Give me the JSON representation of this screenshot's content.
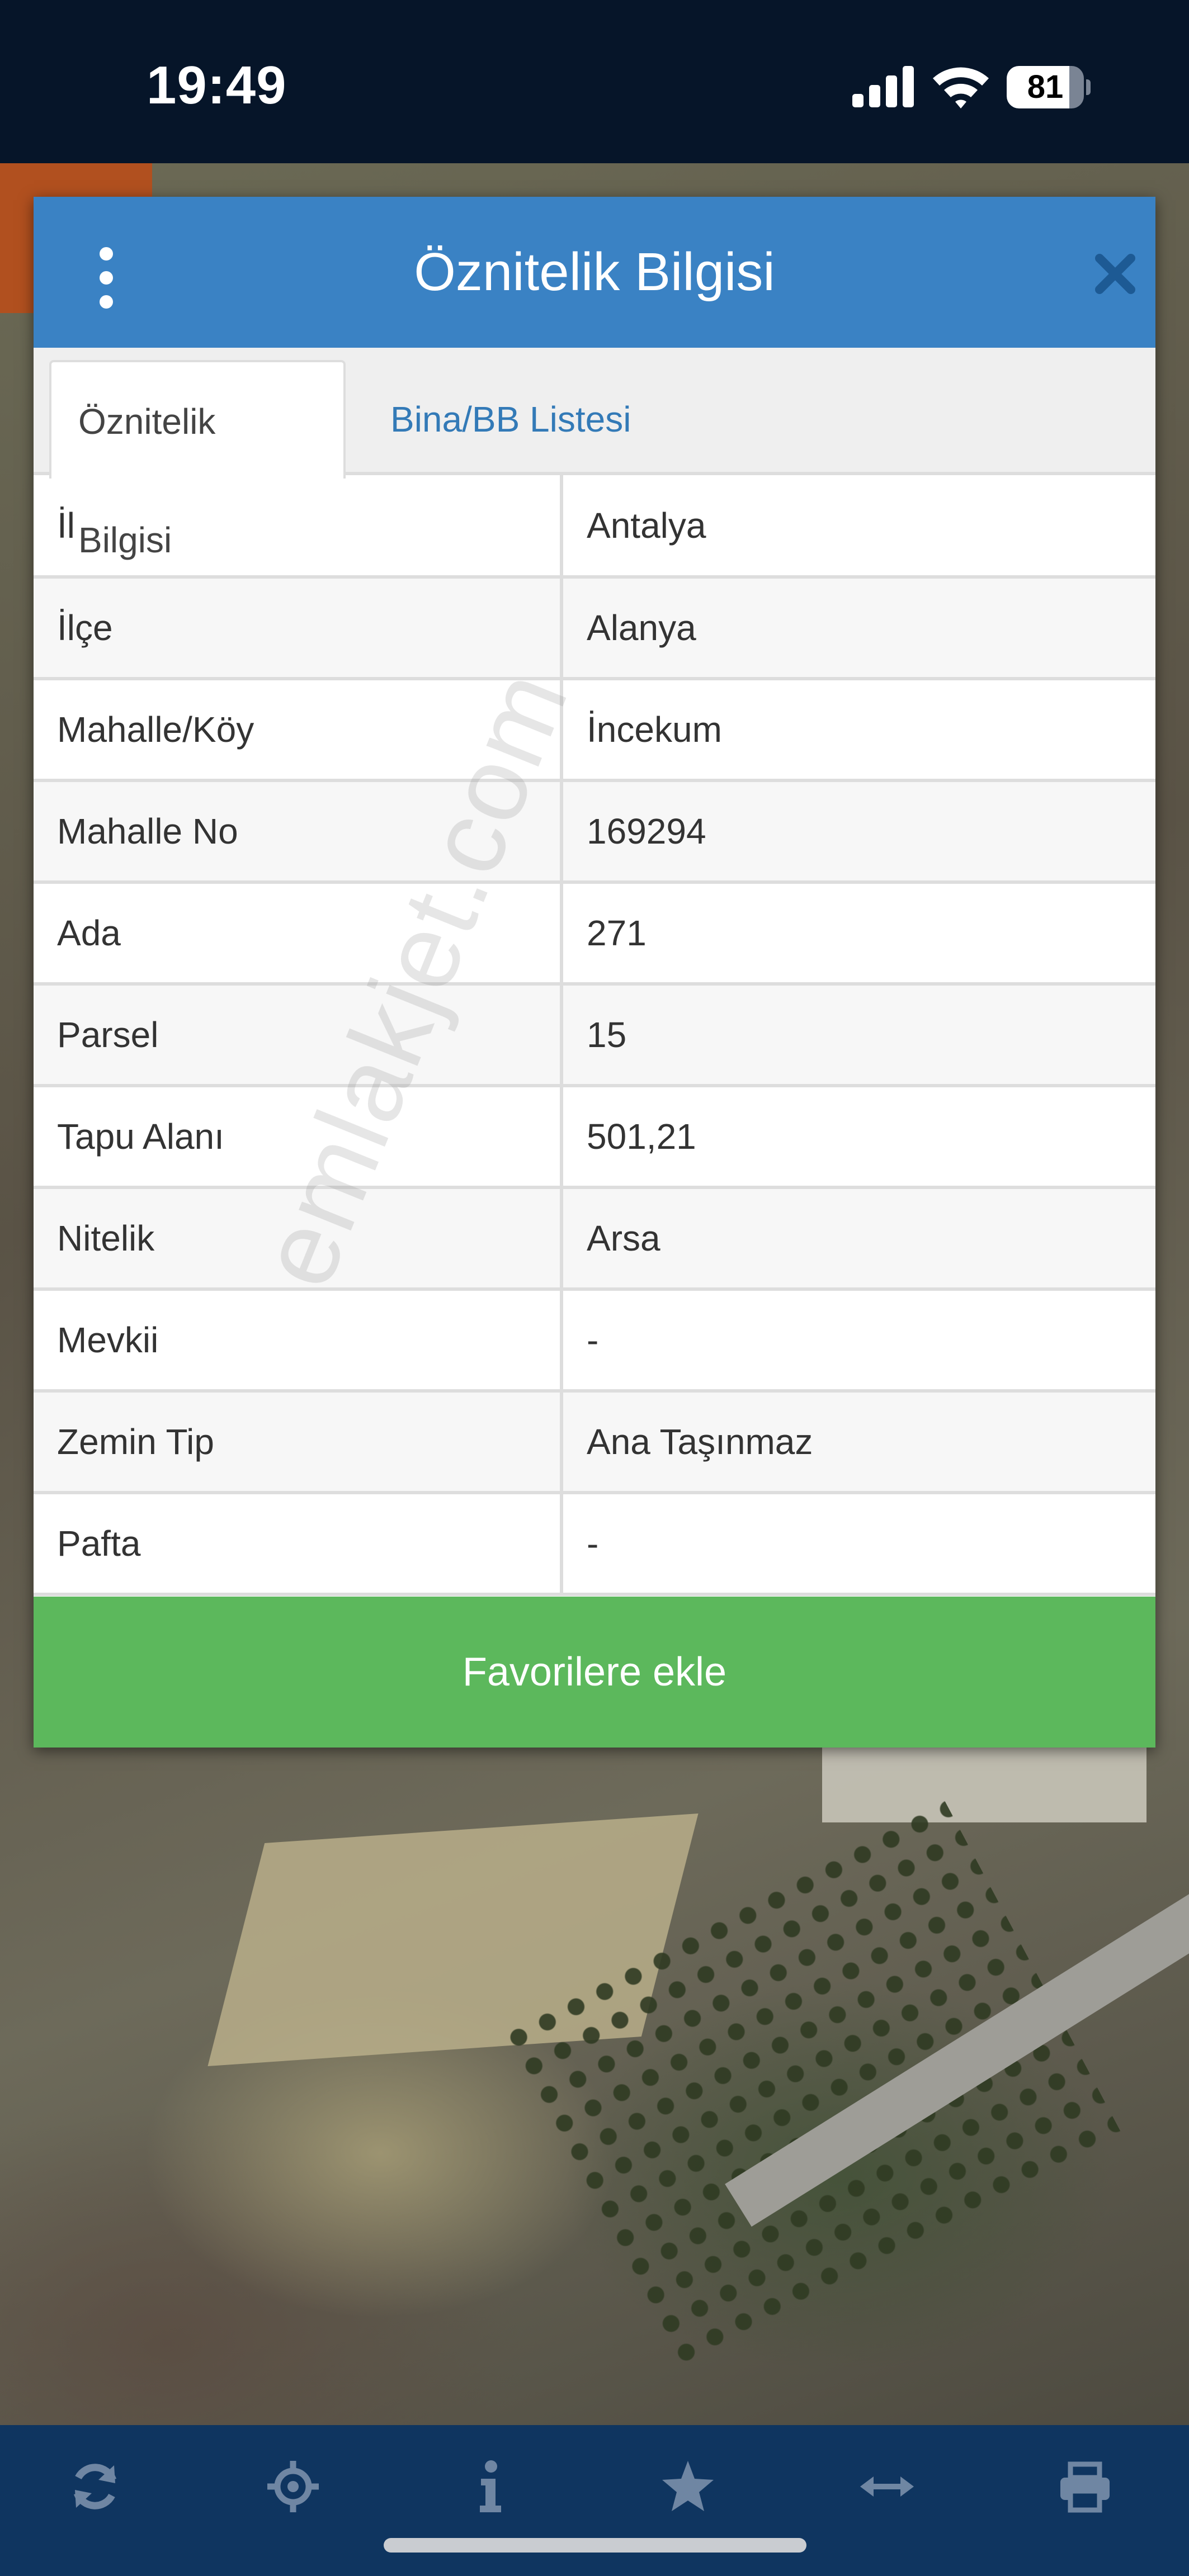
{
  "status_bar": {
    "time": "19:49",
    "battery_level": "81",
    "battery_fraction": 0.81,
    "icons": [
      "signal-icon",
      "wifi-icon",
      "battery-icon"
    ]
  },
  "dialog": {
    "title": "Öznitelik Bilgisi",
    "menu_icon": "kebab-menu-icon",
    "close_icon": "close-icon",
    "tabs": [
      {
        "label": "Öznitelik Bilgisi",
        "active": true
      },
      {
        "label": "Bina/BB Listesi",
        "active": false
      }
    ],
    "rows": [
      {
        "label": "İl",
        "value": "Antalya"
      },
      {
        "label": "İlçe",
        "value": "Alanya"
      },
      {
        "label": "Mahalle/Köy",
        "value": "İncekum"
      },
      {
        "label": "Mahalle No",
        "value": "169294"
      },
      {
        "label": "Ada",
        "value": "271"
      },
      {
        "label": "Parsel",
        "value": "15"
      },
      {
        "label": "Tapu Alanı",
        "value": "501,21"
      },
      {
        "label": "Nitelik",
        "value": "Arsa"
      },
      {
        "label": "Mevkii",
        "value": "-"
      },
      {
        "label": "Zemin Tip",
        "value": "Ana Taşınmaz"
      },
      {
        "label": "Pafta",
        "value": "-"
      }
    ],
    "favorite_button": "Favorilere ekle"
  },
  "watermark": "emlakjet.com",
  "toolbar": {
    "icons": [
      "refresh-icon",
      "locate-icon",
      "info-icon",
      "star-icon",
      "measure-icon",
      "print-icon"
    ]
  },
  "colors": {
    "header_blue": "#3a82c4",
    "tab_link": "#337ab7",
    "button_green": "#5cb85c",
    "toolbar": "#0f3560",
    "status_bar": "#061529"
  }
}
